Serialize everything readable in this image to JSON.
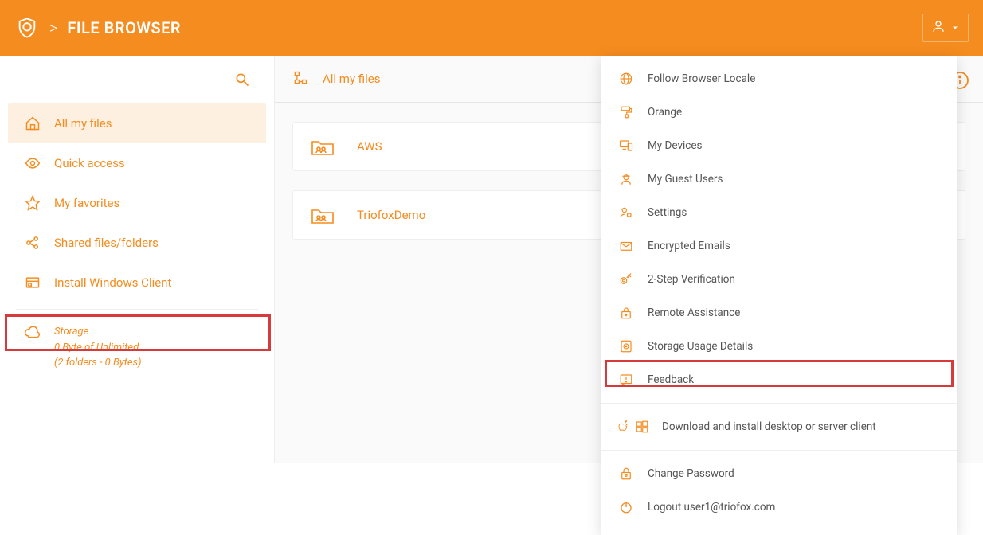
{
  "header": {
    "title": "FILE BROWSER",
    "separator": ">"
  },
  "sidebar": {
    "items": [
      {
        "label": "All my files"
      },
      {
        "label": "Quick access"
      },
      {
        "label": "My favorites"
      },
      {
        "label": "Shared files/folders"
      },
      {
        "label": "Install Windows Client"
      }
    ],
    "storage": {
      "title": "Storage",
      "line1": "0 Byte of Unlimited",
      "line2": "(2 folders - 0 Bytes)"
    }
  },
  "main": {
    "breadcrumb": "All my files",
    "folders": [
      {
        "label": "AWS"
      },
      {
        "label": "TriofoxDemo"
      }
    ]
  },
  "dropdown": {
    "items": [
      {
        "label": "Follow Browser Locale"
      },
      {
        "label": "Orange"
      },
      {
        "label": "My Devices"
      },
      {
        "label": "My Guest Users"
      },
      {
        "label": "Settings"
      },
      {
        "label": "Encrypted Emails"
      },
      {
        "label": "2-Step Verification"
      },
      {
        "label": "Remote Assistance"
      },
      {
        "label": "Storage Usage Details"
      },
      {
        "label": "Feedback"
      },
      {
        "label": "Download and install desktop or server client"
      },
      {
        "label": "Change Password"
      },
      {
        "label": "Logout user1@triofox.com"
      }
    ]
  }
}
